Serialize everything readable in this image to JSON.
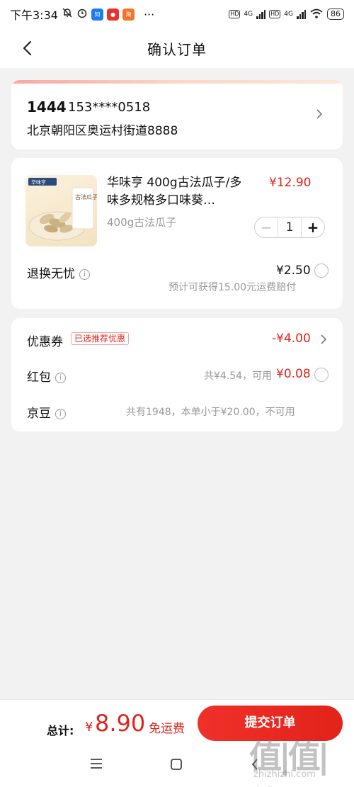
{
  "status_bar": {
    "time": "下午3:34",
    "app_icons": [
      "bell-off-icon",
      "alarm-icon",
      "zhihu-app-icon",
      "app-icon-red",
      "taobao-app-icon"
    ],
    "more": "···",
    "network": "4G",
    "battery": "86"
  },
  "header": {
    "title": "确认订单"
  },
  "address": {
    "name": "1444",
    "phone": "153****0518",
    "line": "北京朝阳区奥运村街道8888"
  },
  "product": {
    "title": "华味亨 400g古法瓜子/多味多规格多口味葵…",
    "price": "¥12.90",
    "spec": "400g古法瓜子",
    "quantity": "1",
    "image_brand": "华味亨",
    "image_label": "古法瓜子"
  },
  "service": {
    "label": "退换无忧",
    "price": "¥2.50",
    "note": "预计可获得15.00元运费赔付"
  },
  "coupon": {
    "label": "优惠券",
    "badge": "已选推荐优惠",
    "value": "-¥4.00"
  },
  "redpacket": {
    "label": "红包",
    "info": "共¥4.54，可用",
    "value": "¥0.08"
  },
  "jingdou": {
    "label": "京豆",
    "info": "共有1948，本单小于¥20.00，不可用"
  },
  "footer": {
    "total_label": "总计:",
    "currency": "¥",
    "total_value": "8.90",
    "free_shipping": "免运费",
    "submit_label": "提交订单"
  },
  "watermark": {
    "main": "值|值|值",
    "sub": "zhizhizhi.com"
  },
  "colors": {
    "accent": "#e2231a",
    "background": "#f2f2f2"
  }
}
